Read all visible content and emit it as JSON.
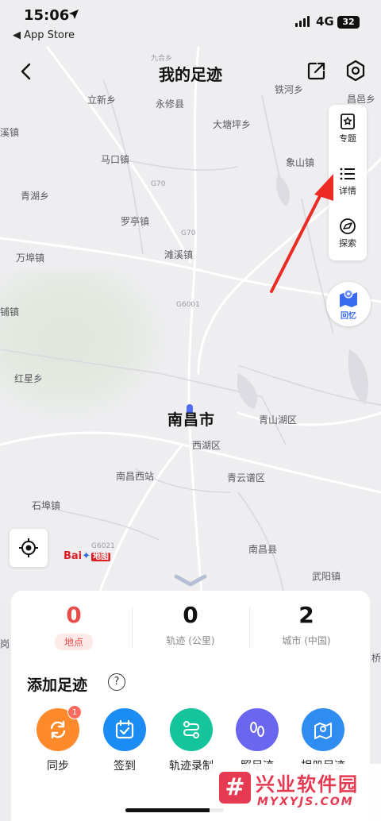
{
  "status_bar": {
    "time": "15:06",
    "back_app": "◀ App Store",
    "network": "4G",
    "battery": "32"
  },
  "nav": {
    "title": "我的足迹"
  },
  "map": {
    "places": [
      {
        "name": "九合乡",
        "cls": "small"
      },
      {
        "name": "铁河乡",
        "cls": ""
      },
      {
        "name": "昌邑乡",
        "cls": ""
      },
      {
        "name": "立新乡",
        "cls": ""
      },
      {
        "name": "永修县",
        "cls": ""
      },
      {
        "name": "大塘坪乡",
        "cls": ""
      },
      {
        "name": "溪镇",
        "cls": ""
      },
      {
        "name": "马口镇",
        "cls": ""
      },
      {
        "name": "象山镇",
        "cls": ""
      },
      {
        "name": "G70",
        "cls": "small"
      },
      {
        "name": "青湖乡",
        "cls": ""
      },
      {
        "name": "罗亭镇",
        "cls": ""
      },
      {
        "name": "G70",
        "cls": "small"
      },
      {
        "name": "万埠镇",
        "cls": ""
      },
      {
        "name": "滩溪镇",
        "cls": ""
      },
      {
        "name": "G6001",
        "cls": "small"
      },
      {
        "name": "铺镇",
        "cls": ""
      },
      {
        "name": "红星乡",
        "cls": ""
      },
      {
        "name": "青山湖区",
        "cls": ""
      },
      {
        "name": "西湖区",
        "cls": ""
      },
      {
        "name": "南昌西站",
        "cls": ""
      },
      {
        "name": "青云谱区",
        "cls": ""
      },
      {
        "name": "石埠镇",
        "cls": ""
      },
      {
        "name": "G6021",
        "cls": "small"
      },
      {
        "name": "南昌县",
        "cls": ""
      },
      {
        "name": "武阳镇",
        "cls": ""
      },
      {
        "name": "岗",
        "cls": ""
      },
      {
        "name": "桥",
        "cls": ""
      }
    ],
    "city": "南昌市"
  },
  "side_menu": {
    "topic": "专题",
    "detail": "详情",
    "explore": "探索",
    "memory": "回忆"
  },
  "baidu": {
    "bai": "Bai",
    "du": "地图"
  },
  "stats": [
    {
      "value": "0",
      "label": "地点"
    },
    {
      "value": "0",
      "label": "轨迹 (公里)"
    },
    {
      "value": "2",
      "label": "城市 (中国)"
    }
  ],
  "add": {
    "title": "添加足迹",
    "help": "?",
    "actions": [
      {
        "label": "同步",
        "badge": "1",
        "color": "#ff8a2b"
      },
      {
        "label": "签到",
        "color": "#1c8cf5"
      },
      {
        "label": "轨迹录制",
        "color": "#14c49c"
      },
      {
        "label": "照足迹",
        "color": "#6a66f0"
      },
      {
        "label": "相册足迹",
        "color": "#2f8cf0"
      }
    ]
  },
  "watermark": {
    "logo": "#",
    "name": "兴业软件园",
    "domain": "MYXYJS.COM"
  }
}
